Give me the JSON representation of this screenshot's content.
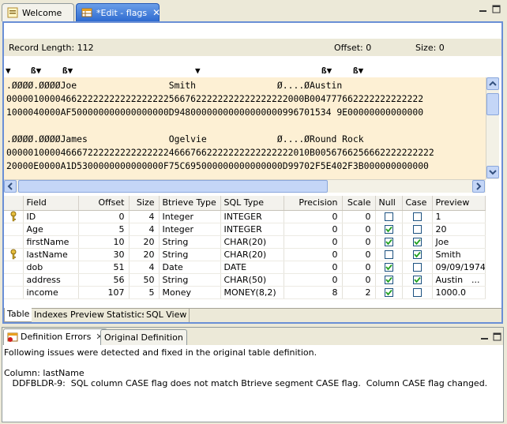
{
  "editor_tabs": [
    {
      "label": "Welcome",
      "active": false
    },
    {
      "label": "*Edit - flags",
      "active": true
    }
  ],
  "record_bar": {
    "record_length": "Record Length: 112",
    "offset": "Offset: 0",
    "size": "Size: 0"
  },
  "markers": [
    "▼",
    "ß▼",
    "ß▼",
    "▼",
    "ß▼",
    "ß▼"
  ],
  "hex_lines": [
    ".ØØØØ.ØØØØJoe                 Smith               Ø....ØAustin",
    "0000010000466222222222222222225667622222222222222222000B004777662222222222222",
    "1000040000AF500000000000000000D94800000000000000000996701534 9E00000000000000",
    "",
    ".ØØØØ.ØØØØJames               Ogelvie             Ø....ØRound Rock",
    "00000100004666722222222222222246667662222222222222222010B0056766256662222222222",
    "20000E0000A1D5300000000000000F75C695000000000000000D99702F5E402F3B000000000000"
  ],
  "table": {
    "headers": [
      "Field",
      "Offset",
      "Size",
      "Btrieve Type",
      "SQL Type",
      "Precision",
      "Scale",
      "Null",
      "Case",
      "Preview"
    ],
    "rows": [
      {
        "key": true,
        "field": "ID",
        "offset": "0",
        "size": "4",
        "btype": "Integer",
        "sqltype": "INTEGER",
        "precision": "0",
        "scale": "0",
        "null": false,
        "case": false,
        "preview": "1"
      },
      {
        "key": false,
        "field": "Age",
        "offset": "5",
        "size": "4",
        "btype": "Integer",
        "sqltype": "INTEGER",
        "precision": "0",
        "scale": "0",
        "null": true,
        "case": false,
        "preview": "20"
      },
      {
        "key": false,
        "field": "firstName",
        "offset": "10",
        "size": "20",
        "btype": "String",
        "sqltype": "CHAR(20)",
        "precision": "0",
        "scale": "0",
        "null": true,
        "case": true,
        "preview": "Joe"
      },
      {
        "key": true,
        "field": "lastName",
        "offset": "30",
        "size": "20",
        "btype": "String",
        "sqltype": "CHAR(20)",
        "precision": "0",
        "scale": "0",
        "null": false,
        "case": true,
        "preview": "Smith"
      },
      {
        "key": false,
        "field": "dob",
        "offset": "51",
        "size": "4",
        "btype": "Date",
        "sqltype": "DATE",
        "precision": "0",
        "scale": "0",
        "null": true,
        "case": false,
        "preview": "09/09/1974"
      },
      {
        "key": false,
        "field": "address",
        "offset": "56",
        "size": "50",
        "btype": "String",
        "sqltype": "CHAR(50)",
        "precision": "0",
        "scale": "0",
        "null": true,
        "case": true,
        "preview": "Austin",
        "preview_extra": "..."
      },
      {
        "key": false,
        "field": "income",
        "offset": "107",
        "size": "5",
        "btype": "Money",
        "sqltype": "MONEY(8,2)",
        "precision": "8",
        "scale": "2",
        "null": true,
        "case": false,
        "preview": "1000.0"
      }
    ]
  },
  "editor_bottom_tabs": [
    {
      "label": "Table",
      "active": true
    },
    {
      "label": "Indexes",
      "active": false
    },
    {
      "label": "Preview",
      "active": false
    },
    {
      "label": "Statistics",
      "active": false
    },
    {
      "label": "SQL View",
      "active": false
    }
  ],
  "lower_tabs": [
    {
      "label": "Definition Errors",
      "active": true
    },
    {
      "label": "Original Definition",
      "active": false
    }
  ],
  "lower_text": [
    "Following issues were detected and fixed in the original table definition.",
    "",
    "Column: lastName",
    "   DDFBLDR-9:  SQL column CASE flag does not match Btrieve segment CASE flag.  Column CASE flag changed."
  ],
  "colors": {
    "active_tab": "#2f6bd0",
    "hex_bg": "#fdf0d4",
    "frame_border": "#6a8fd6"
  }
}
